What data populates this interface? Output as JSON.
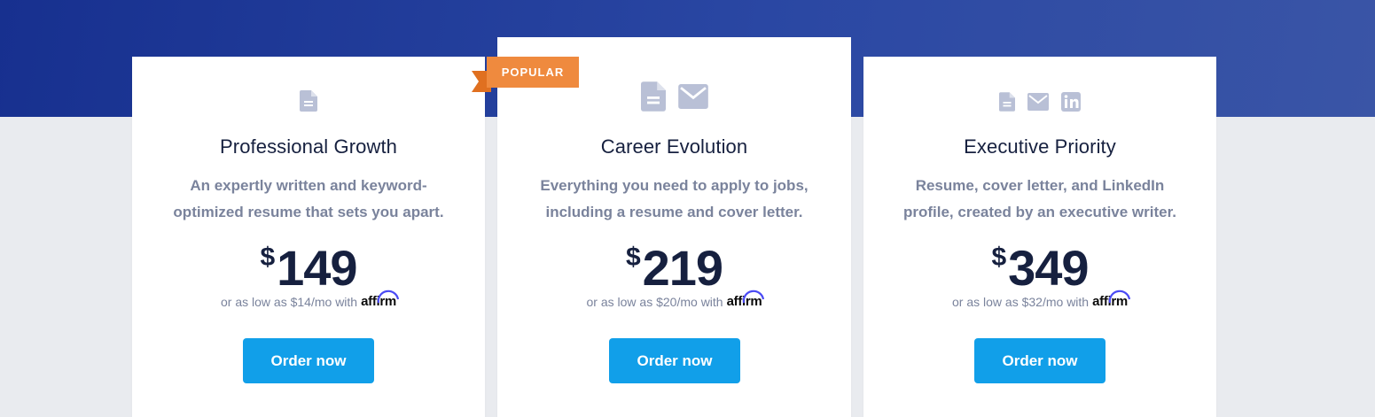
{
  "colors": {
    "hero_band": "#1d3594",
    "page_background": "#e9ebef",
    "card_background": "#ffffff",
    "title": "#16203f",
    "description": "#7a839c",
    "button": "#119fe9",
    "ribbon": "#ef8a3e",
    "icon": "#b9c0d6",
    "affirm_arc": "#4a4af4"
  },
  "badge": {
    "label": "POPULAR"
  },
  "plans": [
    {
      "icons": [
        "document-icon"
      ],
      "title": "Professional Growth",
      "description": "An expertly written and keyword-optimized resume that sets you apart.",
      "currency": "$",
      "price": "149",
      "affirm_text": "or as low as $14/mo with",
      "affirm_logo": "affirm",
      "button_label": "Order now"
    },
    {
      "icons": [
        "document-icon",
        "envelope-icon"
      ],
      "title": "Career Evolution",
      "description": "Everything you need to apply to jobs, including a resume and cover letter.",
      "currency": "$",
      "price": "219",
      "affirm_text": "or as low as $20/mo with",
      "affirm_logo": "affirm",
      "button_label": "Order now"
    },
    {
      "icons": [
        "document-icon",
        "envelope-icon",
        "linkedin-icon"
      ],
      "title": "Executive Priority",
      "description": "Resume, cover letter, and LinkedIn profile, created by an executive writer.",
      "currency": "$",
      "price": "349",
      "affirm_text": "or as low as $32/mo with",
      "affirm_logo": "affirm",
      "button_label": "Order now"
    }
  ]
}
